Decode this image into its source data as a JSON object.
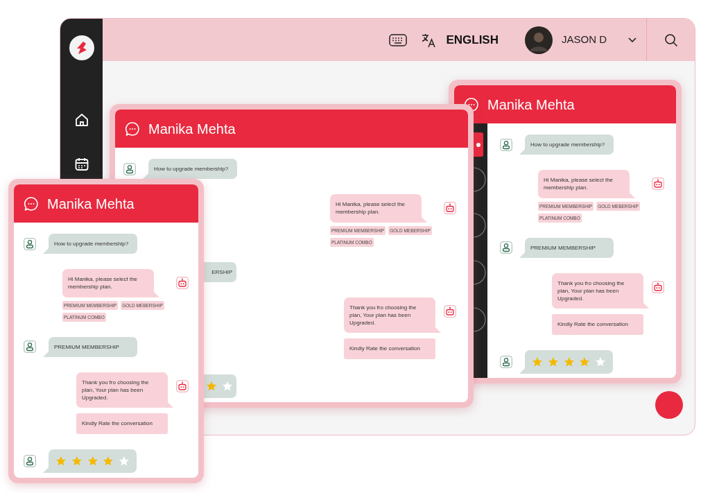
{
  "app": {
    "header": {
      "language": "ENGLISH",
      "user_name": "JASON D"
    }
  },
  "chat_windows": [
    {
      "title": "Manika Mehta",
      "has_sidebar": true,
      "messages": [
        {
          "kind": "user",
          "text": "How to upgrade membership?"
        },
        {
          "kind": "bot",
          "bubbles": [
            "Hi Manika, please select the membership plan."
          ],
          "options": [
            "PREMIUM MEMBERSHIP",
            "GOLD MEBERSHIP",
            "PLATINUM COMBO"
          ]
        },
        {
          "kind": "user",
          "text": "PREMIUM MEMBERSHIP"
        },
        {
          "kind": "bot",
          "bubbles": [
            "Thank you fro choosing the plan, Your plan has been Upgraded.",
            "Kindly Rate the conversation"
          ]
        },
        {
          "kind": "rating",
          "stars": 4
        }
      ]
    },
    {
      "title": "Manika Mehta",
      "has_sidebar": false,
      "messages": [
        {
          "kind": "user",
          "text": "How to upgrade membership?"
        },
        {
          "kind": "bot",
          "bubbles": [
            "Hi Manika, please select the membership plan."
          ],
          "options": [
            "PREMIUM MEMBERSHIP",
            "GOLD MEBERSHIP",
            "PLATINUM COMBO"
          ]
        },
        {
          "kind": "user",
          "text": "ERSHIP",
          "partial": true
        },
        {
          "kind": "bot",
          "bubbles": [
            "Thank you fro choosing the plan, Your plan has been Upgraded.",
            "Kindly Rate the conversation"
          ]
        },
        {
          "kind": "rating",
          "partial": true,
          "visible_stars": [
            {
              "filled": true
            },
            {
              "filled": false
            }
          ]
        }
      ]
    },
    {
      "title": "Manika Mehta",
      "has_sidebar": false,
      "messages": [
        {
          "kind": "user",
          "text": "How to upgrade membership?"
        },
        {
          "kind": "bot",
          "bubbles": [
            "Hi Manika, please select the membership plan."
          ],
          "options": [
            "PREMIUM MEMBERSHIP",
            "GOLD MEBERSHIP",
            "PLATINUM COMBO"
          ]
        },
        {
          "kind": "user",
          "text": "PREMIUM MEMBERSHIP"
        },
        {
          "kind": "bot",
          "bubbles": [
            "Thank you fro choosing the plan, Your plan has been Upgraded.",
            "Kindly Rate the conversation"
          ]
        },
        {
          "kind": "rating",
          "stars": 4
        }
      ]
    }
  ]
}
